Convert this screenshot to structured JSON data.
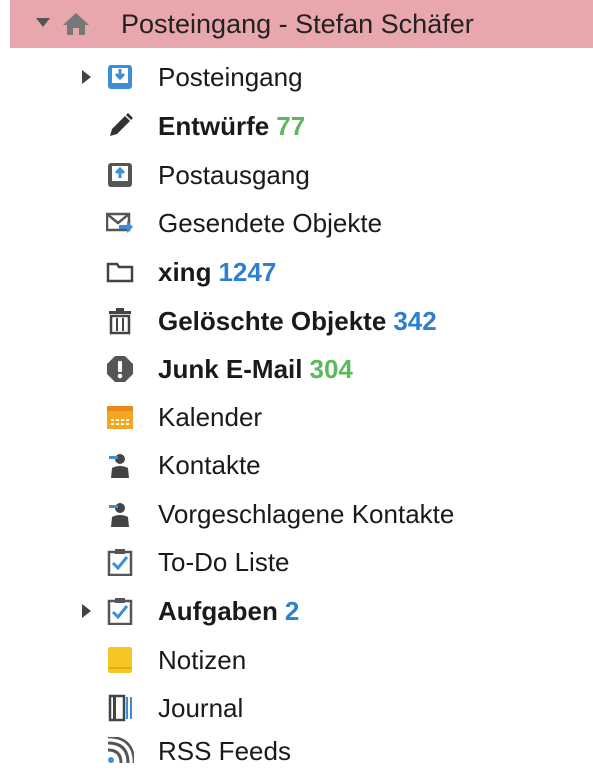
{
  "tree": {
    "root": {
      "label": "Posteingang - Stefan Schäfer",
      "icon": "home-icon"
    },
    "items": [
      {
        "label": "Posteingang",
        "icon": "inbox-icon",
        "bold": false,
        "count": "",
        "expandable": true
      },
      {
        "label": "Entwürfe",
        "icon": "pencil-icon",
        "bold": true,
        "count": "77",
        "count_color": "#5cb85c",
        "expandable": false
      },
      {
        "label": "Postausgang",
        "icon": "outbox-icon",
        "bold": false,
        "count": "",
        "expandable": false
      },
      {
        "label": "Gesendete Objekte",
        "icon": "sent-mail-icon",
        "bold": false,
        "count": "",
        "expandable": false
      },
      {
        "label": "xing",
        "icon": "folder-icon",
        "bold": true,
        "count": "1247",
        "count_color": "#2f7fd0",
        "expandable": false
      },
      {
        "label": "Gelöschte Objekte",
        "icon": "trash-icon",
        "bold": true,
        "count": "342",
        "count_color": "#2f7fd0",
        "expandable": false
      },
      {
        "label": "Junk E-Mail",
        "icon": "junk-icon",
        "bold": true,
        "count": "304",
        "count_color": "#5cb85c",
        "expandable": false
      },
      {
        "label": "Kalender",
        "icon": "calendar-icon",
        "bold": false,
        "count": "",
        "expandable": false
      },
      {
        "label": "Kontakte",
        "icon": "contact-icon",
        "bold": false,
        "count": "",
        "expandable": false
      },
      {
        "label": "Vorgeschlagene Kontakte",
        "icon": "contact-icon",
        "bold": false,
        "count": "",
        "expandable": false
      },
      {
        "label": "To-Do Liste",
        "icon": "task-icon",
        "bold": false,
        "count": "",
        "expandable": false
      },
      {
        "label": "Aufgaben",
        "icon": "task-icon",
        "bold": true,
        "count": "2",
        "count_color": "#2f7fd0",
        "expandable": true
      },
      {
        "label": "Notizen",
        "icon": "note-icon",
        "bold": false,
        "count": "",
        "expandable": false
      },
      {
        "label": "Journal",
        "icon": "journal-icon",
        "bold": false,
        "count": "",
        "expandable": false
      },
      {
        "label": "RSS Feeds",
        "icon": "rss-icon",
        "bold": false,
        "count": "",
        "expandable": false
      }
    ]
  },
  "colors": {
    "selected_bg": "#e8a7ad",
    "count_green": "#5cb85c",
    "count_blue": "#2f7fd0",
    "icon_blue": "#3b8fd6",
    "calendar_orange": "#f5a623",
    "note_yellow": "#f5c623"
  }
}
